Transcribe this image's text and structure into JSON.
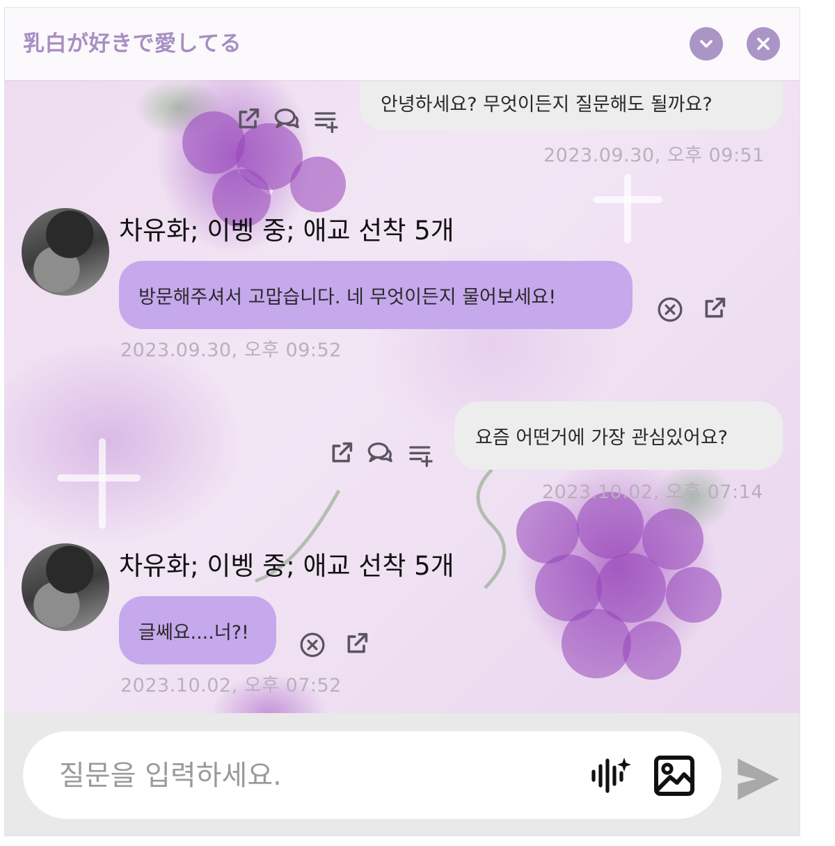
{
  "header": {
    "title": "乳白が好きで愛してる",
    "collapse_icon": "chevron-down-icon",
    "close_icon": "close-icon",
    "accent_color": "#ab94c6"
  },
  "messages": [
    {
      "side": "user",
      "text": "안녕하세요? 무엇이든지 질문해도 될까요?",
      "time": "2023.09.30, 오후 09:51",
      "icons": [
        "share-icon",
        "comment-icon",
        "add-list-icon"
      ]
    },
    {
      "side": "bot",
      "name": "차유화; 이벵 중; 애교 선착 5개",
      "text": "방문해주셔서 고맙습니다. 네 무엇이든지 물어보세요!",
      "time": "2023.09.30, 오후 09:52",
      "icons": [
        "cancel-icon",
        "share-icon"
      ]
    },
    {
      "side": "user",
      "text": "요즘 어떤거에 가장 관심있어요?",
      "time": "2023.10.02, 오후 07:14",
      "icons": [
        "share-icon",
        "comment-icon",
        "add-list-icon"
      ]
    },
    {
      "side": "bot",
      "name": "차유화; 이벵 중; 애교 선착 5개",
      "text": "글쎄요....너?!",
      "time": "2023.10.02, 오후 07:52",
      "icons": [
        "cancel-icon",
        "share-icon"
      ]
    }
  ],
  "composer": {
    "placeholder": "질문을 입력하세요.",
    "value": "",
    "voice_icon": "voice-sparkle-icon",
    "image_icon": "image-icon",
    "send_icon": "send-icon"
  },
  "colors": {
    "bot_bubble": "#c6a8ec",
    "user_bubble": "#ededed",
    "timestamp": "#b8b0bd"
  }
}
